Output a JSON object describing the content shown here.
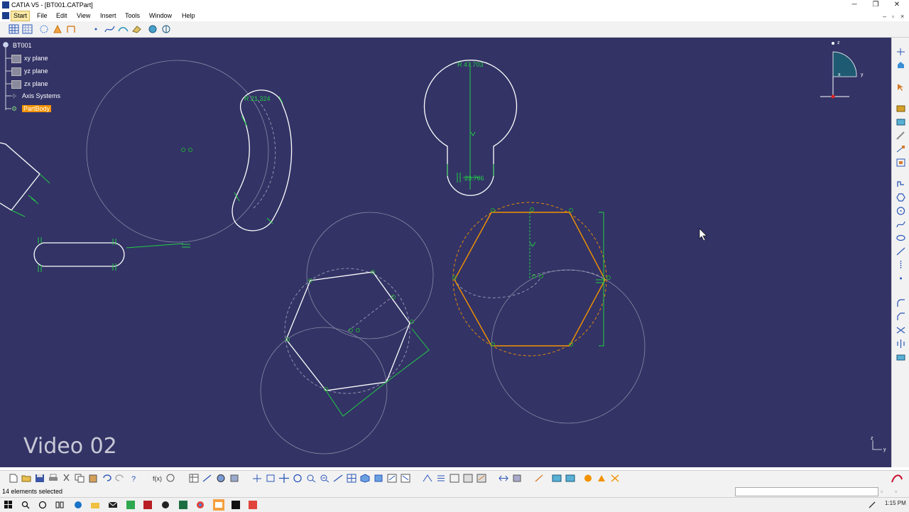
{
  "window": {
    "title": "CATIA V5 - [BT001.CATPart]",
    "controls": {
      "minimize": "─",
      "restore": "❐",
      "close": "✕"
    }
  },
  "menu": {
    "items": [
      "Start",
      "File",
      "Edit",
      "View",
      "Insert",
      "Tools",
      "Window",
      "Help"
    ]
  },
  "tree": {
    "root": "BT001",
    "planes": [
      "xy plane",
      "yz plane",
      "zx plane"
    ],
    "axis_systems": "Axis Systems",
    "part_body": "PartBody"
  },
  "sketch": {
    "dim_radius_top": "R 47.703",
    "dim_radius_arc": "R 21.324",
    "dim_bottom": "23.766",
    "compass_z": "z",
    "compass_x": "x",
    "compass_y": "y"
  },
  "axis_indicator": {
    "z": "z",
    "y": "y"
  },
  "watermark": "Video 02",
  "status": {
    "message": "14 elements selected"
  },
  "taskbar": {
    "time": "1:15 PM"
  },
  "colors": {
    "canvas_bg": "#333366",
    "sketch_white": "#ffffff",
    "constraint_green": "#22cc44",
    "selected_orange": "#f39200",
    "construction_gray": "#8a8aa6"
  }
}
